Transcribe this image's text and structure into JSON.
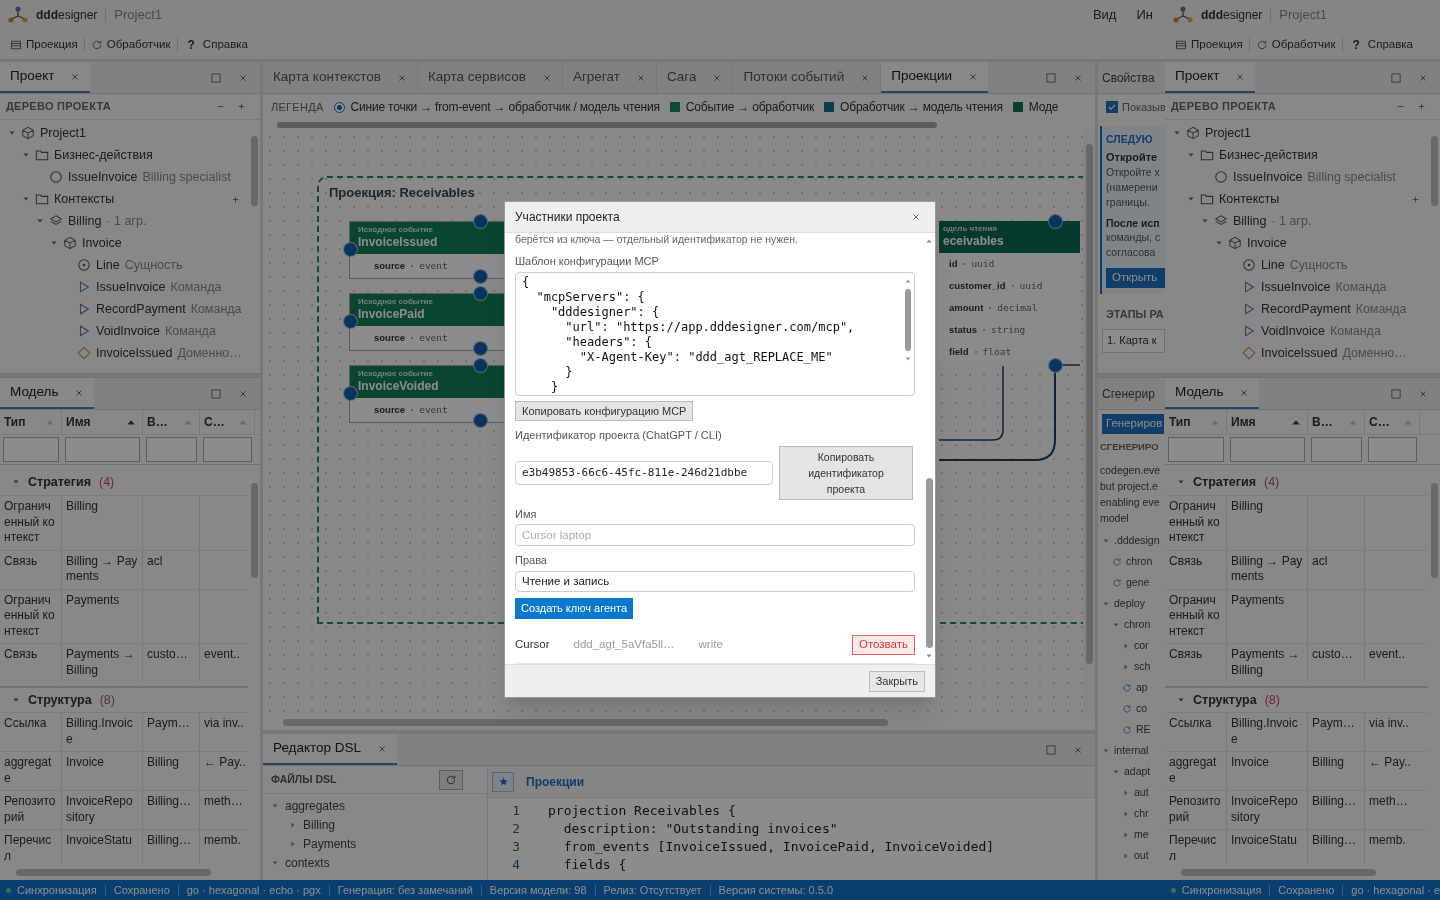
{
  "app": {
    "header": {
      "logo": "**ddd**esigner",
      "project": "Project1",
      "menu": [
        "Вид",
        "Ин"
      ]
    },
    "toolbar": [
      {
        "kind": "list",
        "label": "Проекция"
      },
      {
        "kind": "refresh",
        "label": "Обработчик"
      },
      {
        "kind": "glyph",
        "glyph": "?",
        "label": "Справка"
      }
    ],
    "project_panel": {
      "tabs": [
        {
          "label": "Проект",
          "selected": true
        }
      ],
      "section": "ДЕРЕВО ПРОЕКТА",
      "tree": [
        {
          "kind": "cube",
          "label": "Project1",
          "expanded": true,
          "children": [
            {
              "kind": "folder",
              "label": "Бизнес-действия",
              "expanded": true,
              "children": [
                {
                  "kind": "circle",
                  "label": "IssueInvoice",
                  "note": "Billing specialist"
                }
              ]
            },
            {
              "kind": "folder",
              "label": "Контексты",
              "expanded": true,
              "addable": true,
              "children": [
                {
                  "kind": "layers",
                  "label": "Billing",
                  "note": "· 1 агр.",
                  "expanded": true,
                  "children": [
                    {
                      "kind": "cube",
                      "label": "Invoice",
                      "expanded": true,
                      "children": [
                        {
                          "kind": "target",
                          "label": "Line",
                          "note": "Сущность"
                        },
                        {
                          "kind": "play",
                          "label": "IssueInvoice",
                          "note": "Команда"
                        },
                        {
                          "kind": "play",
                          "label": "RecordPayment",
                          "note": "Команда"
                        },
                        {
                          "kind": "play",
                          "label": "VoidInvoice",
                          "note": "Команда"
                        },
                        {
                          "kind": "diamond",
                          "label": "InvoiceIssued",
                          "note": "Доменно…"
                        }
                      ]
                    }
                  ]
                }
              ]
            }
          ]
        }
      ]
    },
    "model_panel": {
      "tabs": [
        {
          "label": "Модель",
          "selected": true
        }
      ],
      "columns": [
        {
          "label": "Тип",
          "sorted": false
        },
        {
          "label": "Имя",
          "sorted": true
        },
        {
          "label": "В…",
          "sorted": false
        },
        {
          "label": "С…",
          "sorted": false
        }
      ],
      "groups": [
        {
          "title": "Стратегия",
          "count": "(4)",
          "expanded": true,
          "rows": [
            {
              "type": "Ограниченный контекст",
              "name": "Billing"
            },
            {
              "type": "Связь",
              "name": "Billing → Payments",
              "column_3": "acl"
            },
            {
              "type": "Ограниченный контекст",
              "name": "Payments"
            },
            {
              "type": "Связь",
              "name": "Payments → Billing",
              "column_3": "custo…",
              "column_4": "event.."
            }
          ]
        },
        {
          "title": "Структура",
          "count": "(8)",
          "expanded": true,
          "rows": [
            {
              "type": "Ссылка",
              "name": "Billing.Invoice",
              "column_3": "Paym…",
              "column_4": "via inv.."
            },
            {
              "type": "aggregate",
              "name": "Invoice",
              "column_3": "Billing",
              "column_4": "← Pay.."
            },
            {
              "type": "Репозиторий",
              "name": "InvoiceRepository",
              "column_3": "Billing…",
              "column_4": "meth…"
            },
            {
              "type": "Перечисл",
              "name": "InvoiceStatu",
              "column_3": "Billing…",
              "column_4": "memb."
            }
          ]
        }
      ]
    },
    "canvas_view": {
      "tabs": [
        {
          "label": "Карта контекстов",
          "selected": false
        },
        {
          "label": "Карта сервисов",
          "selected": false
        },
        {
          "label": "Агрегат",
          "selected": false
        },
        {
          "label": "Сага",
          "selected": false
        },
        {
          "label": "Потоки событий",
          "selected": false
        },
        {
          "label": "Проекции",
          "selected": true
        }
      ],
      "legend": {
        "title": "ЛЕГЕНДА",
        "items": [
          {
            "kind": "radio",
            "selected": true,
            "label": "Синие точки → from-event → обработчик / модель чтения"
          },
          {
            "kind": "swatch",
            "color": "#0b4a33",
            "label": "Событие → обработчик"
          },
          {
            "kind": "swatch",
            "color": "#0a3f4a",
            "label": "Обработчик → модель чтения"
          },
          {
            "kind": "swatch",
            "color": "#093e32",
            "label": "Моде"
          }
        ]
      },
      "group_title": "Проекция: Receivables",
      "sources": [
        {
          "caption": "Исходное событие",
          "name": "InvoiceIssued",
          "field": "source",
          "type": "event"
        },
        {
          "caption": "Исходное событие",
          "name": "InvoicePaid",
          "field": "source",
          "type": "event"
        },
        {
          "caption": "Исходное событие",
          "name": "InvoiceVoided",
          "field": "source",
          "type": "event"
        }
      ],
      "read_model": {
        "caption": "одель чтения",
        "name": "eceivables",
        "fields": [
          {
            "name": "id",
            "type": "uuid"
          },
          {
            "name": "customer_id",
            "type": "uuid"
          },
          {
            "name": "amount",
            "type": "decimal"
          },
          {
            "name": "status",
            "type": "string"
          },
          {
            "name": "field",
            "type": "float"
          }
        ]
      }
    },
    "dsl_editor": {
      "tabs": [
        {
          "label": "Редактор DSL",
          "selected": true
        }
      ],
      "files_title": "ФАЙЛЫ DSL",
      "files": [
        {
          "label": "aggregates",
          "expanded": true,
          "children": [
            {
              "label": "Billing",
              "expanded": false
            },
            {
              "label": "Payments",
              "expanded": false
            }
          ]
        },
        {
          "label": "contexts",
          "expanded": true
        }
      ],
      "file_tab": "Проекции",
      "lines": [
        {
          "number": "1",
          "code": "projection Receivables {"
        },
        {
          "number": "2",
          "code": "  description: \"Outstanding invoices\""
        },
        {
          "number": "3",
          "code": "  from_events [InvoiceIssued, InvoicePaid, InvoiceVoided]"
        },
        {
          "number": "4",
          "code": "  fields {"
        }
      ]
    },
    "properties_strip": {
      "tabs": [
        {
          "label": "Свойства",
          "selected": false
        }
      ],
      "checkbox": {
        "label": "Показыв",
        "checked": true
      },
      "heading": "СЛЕДУЮ",
      "title": "Откройте",
      "lines": [
        "Откройте х",
        "(намерени",
        "границы."
      ],
      "subtitle": "После исп",
      "lines2": [
        "команды, с",
        "согласова"
      ],
      "button": "Открыть",
      "section": "ЭТАПЫ РА",
      "step": "1. Карта к"
    },
    "generated_strip": {
      "tabs": [
        {
          "label": "Сгенерир",
          "selected": false
        }
      ],
      "button": "Генериров",
      "section": "СГЕНЕРИРО",
      "message": [
        "codegen.eve",
        "but project.e",
        "enabling eve",
        "model"
      ],
      "files": [
        {
          "kind": "folder",
          "label": ".dddesign",
          "expanded": true,
          "children": [
            {
              "kind": "file",
              "label": "chron"
            },
            {
              "kind": "file",
              "label": "gene"
            }
          ]
        },
        {
          "kind": "folder",
          "label": "deploy",
          "expanded": true,
          "children": [
            {
              "kind": "folder",
              "label": "chron",
              "expanded": true,
              "children": [
                {
                  "kind": "folder",
                  "label": "cor",
                  "expanded": false
                },
                {
                  "kind": "folder",
                  "label": "sch",
                  "expanded": false
                },
                {
                  "kind": "file",
                  "label": "ap"
                },
                {
                  "kind": "file",
                  "label": "co"
                },
                {
                  "kind": "file",
                  "label": "RE"
                }
              ]
            }
          ]
        },
        {
          "kind": "folder",
          "label": "internal",
          "expanded": true,
          "children": [
            {
              "kind": "folder",
              "label": "adapt",
              "expanded": true,
              "children": [
                {
                  "kind": "folder",
                  "label": "aut",
                  "expanded": false
                },
                {
                  "kind": "folder",
                  "label": "chr",
                  "expanded": false
                },
                {
                  "kind": "folder",
                  "label": "me",
                  "expanded": false
                },
                {
                  "kind": "folder",
                  "label": "out",
                  "expanded": false
                }
              ]
            }
          ]
        }
      ]
    },
    "status_bar": [
      {
        "kind": "sync",
        "label": "Синхронизация"
      },
      {
        "kind": "text",
        "label": "Сохранено"
      },
      {
        "kind": "text",
        "label": "go · hexagonal · echo · pgx"
      },
      {
        "kind": "text",
        "label": "Генерация: без замечаний"
      },
      {
        "kind": "text",
        "label": "Версия модели: 98"
      },
      {
        "kind": "text",
        "label": "Релиз: Отсутствует"
      },
      {
        "kind": "text",
        "label": "Версия системы: 0.5.0"
      }
    ]
  },
  "overlay_copy": {
    "header": {
      "logo": "**ddd**esigner",
      "project": "Project1"
    },
    "toolbar": [
      {
        "kind": "list",
        "label": "Проекция"
      },
      {
        "kind": "refresh",
        "label": "Обработчик"
      },
      {
        "kind": "glyph",
        "glyph": "?",
        "label": "Справка"
      }
    ],
    "project_panel": {
      "tabs": [
        {
          "label": "Проект",
          "selected": true
        }
      ],
      "section": "ДЕРЕВО ПРОЕКТА",
      "tree": [
        {
          "kind": "cube",
          "label": "Project1",
          "expanded": true,
          "children": [
            {
              "kind": "folder",
              "label": "Бизнес-действия",
              "expanded": true,
              "children": [
                {
                  "kind": "circle",
                  "label": "IssueInvoice",
                  "note": "Billing specialist"
                }
              ]
            },
            {
              "kind": "folder",
              "label": "Контексты",
              "expanded": true,
              "addable": true,
              "children": [
                {
                  "kind": "layers",
                  "label": "Billing",
                  "note": "· 1 агр.",
                  "expanded": true,
                  "children": [
                    {
                      "kind": "cube",
                      "label": "Invoice",
                      "expanded": true,
                      "children": [
                        {
                          "kind": "target",
                          "label": "Line",
                          "note": "Сущность"
                        },
                        {
                          "kind": "play",
                          "label": "IssueInvoice",
                          "note": "Команда"
                        },
                        {
                          "kind": "play",
                          "label": "RecordPayment",
                          "note": "Команда"
                        },
                        {
                          "kind": "play",
                          "label": "VoidInvoice",
                          "note": "Команда"
                        },
                        {
                          "kind": "diamond",
                          "label": "InvoiceIssued",
                          "note": "Доменно…"
                        }
                      ]
                    }
                  ]
                }
              ]
            }
          ]
        }
      ]
    },
    "model_panel": {
      "tabs": [
        {
          "label": "Модель",
          "selected": true
        }
      ],
      "columns": [
        {
          "label": "Тип",
          "sorted": false
        },
        {
          "label": "Имя",
          "sorted": true
        },
        {
          "label": "В…",
          "sorted": false
        },
        {
          "label": "С…",
          "sorted": false
        }
      ],
      "groups": [
        {
          "title": "Стратегия",
          "count": "(4)",
          "expanded": true,
          "rows": [
            {
              "type": "Ограниченный контекст",
              "name": "Billing"
            },
            {
              "type": "Связь",
              "name": "Billing → Payments",
              "column_3": "acl"
            },
            {
              "type": "Ограниченный контекст",
              "name": "Payments"
            },
            {
              "type": "Связь",
              "name": "Payments → Billing",
              "column_3": "custo…",
              "column_4": "event.."
            }
          ]
        },
        {
          "title": "Структура",
          "count": "(8)",
          "expanded": true,
          "rows": [
            {
              "type": "Ссылка",
              "name": "Billing.Invoice",
              "column_3": "Paym…",
              "column_4": "via inv.."
            },
            {
              "type": "aggregate",
              "name": "Invoice",
              "column_3": "Billing",
              "column_4": "← Pay.."
            },
            {
              "type": "Репозиторий",
              "name": "InvoiceRepository",
              "column_3": "Billing…",
              "column_4": "meth…"
            },
            {
              "type": "Перечисл",
              "name": "InvoiceStatu",
              "column_3": "Billing…",
              "column_4": "memb."
            }
          ]
        }
      ]
    },
    "status_bar": [
      {
        "kind": "sync",
        "label": "Синхронизация"
      },
      {
        "kind": "text",
        "label": "Сохранено"
      },
      {
        "kind": "text",
        "label": "go · hexagonal · e"
      }
    ]
  },
  "dialog": {
    "title": "Участники проекта",
    "intro": "берётся из ключа — отдельный идентификатор не нужен.",
    "config_label": "Шаблон конфигурации MCP",
    "config": "{\n  \"mcpServers\": {\n    \"dddesigner\": {\n      \"url\": \"https://app.dddesigner.com/mcp\",\n      \"headers\": {\n        \"X-Agent-Key\": \"ddd_agt_REPLACE_ME\"\n      }\n    }",
    "copy_config": "Копировать конфигурацию MCP",
    "id_label": "Идентификатор проекта (ChatGPT / CLI)",
    "project_id": "e3b49853-66c6-45fc-811e-246d21dbbe",
    "copy_id": "Копировать идентификатор проекта",
    "name_label": "Имя",
    "name_placeholder": "Cursor laptop",
    "rights_label": "Права",
    "rights": "Чтение и запись",
    "create": "Создать ключ агента",
    "keys": [
      {
        "name": "Cursor",
        "key": "ddd_agt_5aVfa5ll…",
        "scope": "write",
        "revoke": "Отозвать"
      }
    ],
    "close": "Закрыть"
  }
}
